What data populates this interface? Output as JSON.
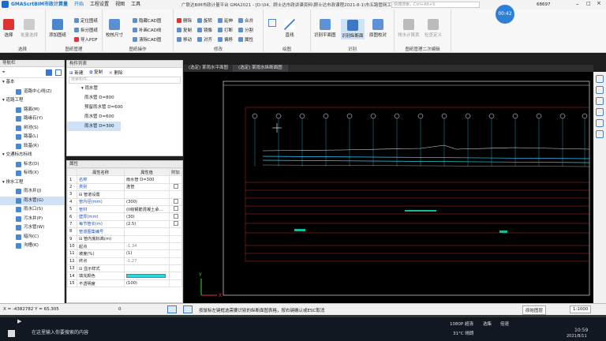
{
  "titlebar": {
    "app": "GMAScrtBIM市政计算量",
    "tabs": [
      "开始",
      "工程设置",
      "视图",
      "工具"
    ],
    "window_title": "广联达BIM市政计量平台 GMA2021 - [D:\\04、顾士达市政讲课资料\\顾士达市政课程2021-8-1\\市五路管网工程.GMA]",
    "search_placeholder": "快捷搜索，Ctrl+Alt+S",
    "user": "68697",
    "timer": "00:42"
  },
  "ribbon": {
    "groups": [
      {
        "label": "选择"
      },
      {
        "label": "图纸管理"
      },
      {
        "label": "图纸操作"
      },
      {
        "label": "修改"
      },
      {
        "label": "绘图"
      },
      {
        "label": "识别"
      },
      {
        "label": "图纸管理二次编辑"
      }
    ],
    "select": {
      "select": "选择",
      "batch": "批量选择"
    },
    "drawing": {
      "add": "添加图纸",
      "locate": "定位图纸",
      "split": "拆分图纸",
      "import_pdf": "导入PDF"
    },
    "ops": {
      "calibrate": "校核尺寸",
      "hide_cad": "隐藏CAD图",
      "supplement": "补画CAD线",
      "clear": "清除CAD图"
    },
    "modify": {
      "delete": "删除",
      "copy": "复制",
      "move": "移动",
      "rotate": "旋转",
      "mirror": "镜像",
      "align": "对齐",
      "extend": "延伸",
      "trim": "打断",
      "offset": "偏移",
      "merge": "合并",
      "split2": "分割",
      "properties": "属性"
    },
    "draw": {
      "line": "直线"
    },
    "recognize": {
      "plan": "识别平面图",
      "profile": "识别纵断面",
      "origin": "原图校对"
    },
    "edit2": {
      "pipe_calc": "排水计算表",
      "check": "检查定义"
    }
  },
  "nav": {
    "header": "导航栏",
    "tree": [
      {
        "type": "grp",
        "label": "基本"
      },
      {
        "type": "itm",
        "label": "道路中心线(Z)"
      },
      {
        "type": "grp",
        "label": "道路工程"
      },
      {
        "type": "itm",
        "label": "路面(M)"
      },
      {
        "type": "itm",
        "label": "路缘石(Y)"
      },
      {
        "type": "itm",
        "label": "树池(S)"
      },
      {
        "type": "itm",
        "label": "路基(L)"
      },
      {
        "type": "itm",
        "label": "软基(R)"
      },
      {
        "type": "grp",
        "label": "交通标志标线"
      },
      {
        "type": "itm",
        "label": "标志(D)"
      },
      {
        "type": "itm",
        "label": "标线(X)"
      },
      {
        "type": "grp",
        "label": "排水工程"
      },
      {
        "type": "itm",
        "label": "雨水井(J)"
      },
      {
        "type": "itm",
        "label": "雨水管(G)",
        "selected": true
      },
      {
        "type": "itm",
        "label": "雨水口(S)"
      },
      {
        "type": "itm",
        "label": "污水井(P)"
      },
      {
        "type": "itm",
        "label": "污水管(W)"
      },
      {
        "type": "itm",
        "label": "暗沟(C)"
      },
      {
        "type": "itm",
        "label": "沟槽(K)"
      }
    ]
  },
  "components": {
    "header": "构件列表",
    "new": "新建",
    "copy": "复制",
    "delete": "删除",
    "search_placeholder": "搜索构件...",
    "tree": [
      {
        "label": "雨水管",
        "level": 0
      },
      {
        "label": "雨水管 D=800",
        "level": 1
      },
      {
        "label": "预留雨水管 D=600",
        "level": 1
      },
      {
        "label": "雨水管 D=600",
        "level": 1
      },
      {
        "label": "雨水管 D=300",
        "level": 1,
        "selected": true
      }
    ]
  },
  "properties": {
    "header": "属性",
    "col_name": "属性名称",
    "col_value": "属性值",
    "col_extra": "附加",
    "rows": [
      {
        "n": "1",
        "name": "名称",
        "value": "雨水管 D=300",
        "blue": true,
        "cb": false
      },
      {
        "n": "2",
        "name": "类别",
        "value": "连管",
        "blue": true,
        "cb": true
      },
      {
        "n": "3",
        "name": "⊟ 管道设置",
        "value": "",
        "cb": false
      },
      {
        "n": "4",
        "name": "管内径(mm)",
        "value": "(300)",
        "blue": true,
        "cb": true
      },
      {
        "n": "5",
        "name": "管材",
        "value": "(II级钢筋混凝土承...",
        "blue": true,
        "cb": true
      },
      {
        "n": "6",
        "name": "壁厚(mm)",
        "value": "(30)",
        "blue": true,
        "cb": true
      },
      {
        "n": "7",
        "name": "每节管长(m)",
        "value": "(2.5)",
        "blue": true,
        "cb": true
      },
      {
        "n": "8",
        "name": "管道图集编号",
        "value": "",
        "blue": true,
        "cb": false
      },
      {
        "n": "9",
        "name": "⊟ 管内底标高(m)",
        "value": "",
        "cb": false
      },
      {
        "n": "10",
        "name": "起点",
        "value": "-1.34",
        "gray": true,
        "cb": false
      },
      {
        "n": "11",
        "name": "坡度(%)",
        "value": "(1)",
        "cb": false
      },
      {
        "n": "12",
        "name": "终点",
        "value": "-1.27",
        "gray": true,
        "cb": false
      },
      {
        "n": "13",
        "name": "⊟ 显示样式",
        "value": "",
        "cb": false
      },
      {
        "n": "14",
        "name": "填充颜色",
        "value": "",
        "swatch": true,
        "cb": false
      },
      {
        "n": "15",
        "name": "不透明度",
        "value": "(100)",
        "cb": false
      }
    ]
  },
  "canvas": {
    "tabs": [
      "(选定) 某雨水平面图",
      "(选定) 某雨水纵断面图"
    ]
  },
  "status": {
    "coords": "X = -4382782 Y = 65.305",
    "zero": "0",
    "hint": "按鼠标左键框选需要识别的纵断面图表格，按右键确认或ESC取消",
    "layer": "原始图层",
    "scale": "1:1000"
  },
  "taskbar": {
    "search": "在这里输入你要搜索的内容",
    "temp": "31°C 晴朗",
    "time": "10:59",
    "date": "2021/8/11",
    "res": "1080P 超清",
    "speed": "选集",
    "rate": "倍速"
  },
  "colors": {
    "accent": "#1a73c9",
    "selected": "#cfe3f8",
    "canvas_bg": "#000000",
    "fill": "#2ad8e0"
  }
}
